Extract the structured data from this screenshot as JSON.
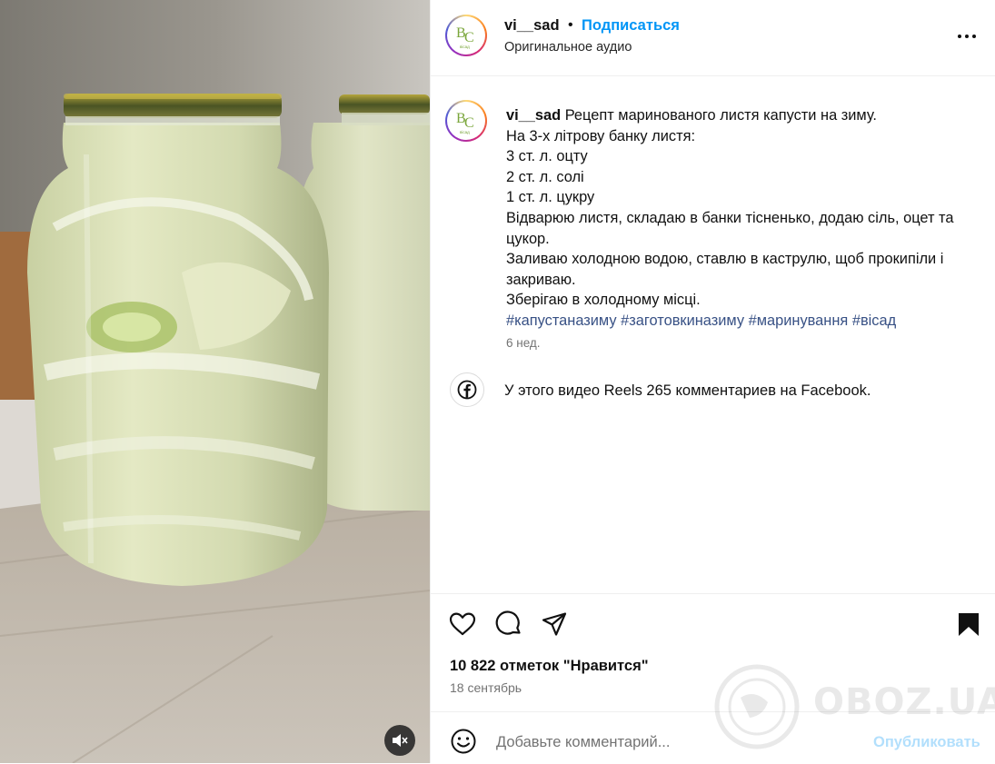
{
  "header": {
    "username": "vi__sad",
    "separator": "•",
    "follow_label": "Подписаться",
    "audio_label": "Оригинальное аудио",
    "avatar_text": "ВС",
    "avatar_subtext": "вісад"
  },
  "caption": {
    "username": "vi__sad",
    "lines": [
      "Рецепт маринованого листя капусти на зиму.",
      "На 3-х літрову банку листя:",
      "3 ст. л. оцту",
      "2 ст. л. солі",
      "1 ст. л. цукру",
      "Відварюю листя, складаю в банки тісненько, додаю сіль, оцет та цукор.",
      "Заливаю холодною водою, ставлю в каструлю, щоб прокипіли і закриваю.",
      "Зберігаю в холодному місці."
    ],
    "hashtags": [
      "#капустаназиму",
      "#заготовкиназиму",
      "#маринування",
      "#вісад"
    ],
    "age": "6 нед."
  },
  "facebook_note": "У этого видео Reels 265 комментариев на Facebook.",
  "likes": "10 822 отметок \"Нравится\"",
  "post_date": "18 сентябрь",
  "comment": {
    "placeholder": "Добавьте комментарий...",
    "publish_label": "Опубликовать"
  },
  "watermark": "OBOZ.UA",
  "colors": {
    "accent": "#0095f6",
    "hashtag": "#385185",
    "publish_disabled": "#b2dffc",
    "muted_text": "#737373"
  },
  "icons": [
    "heart-icon",
    "comment-icon",
    "share-icon",
    "bookmark-icon",
    "emoji-icon",
    "facebook-icon",
    "more-icon",
    "mute-icon"
  ]
}
